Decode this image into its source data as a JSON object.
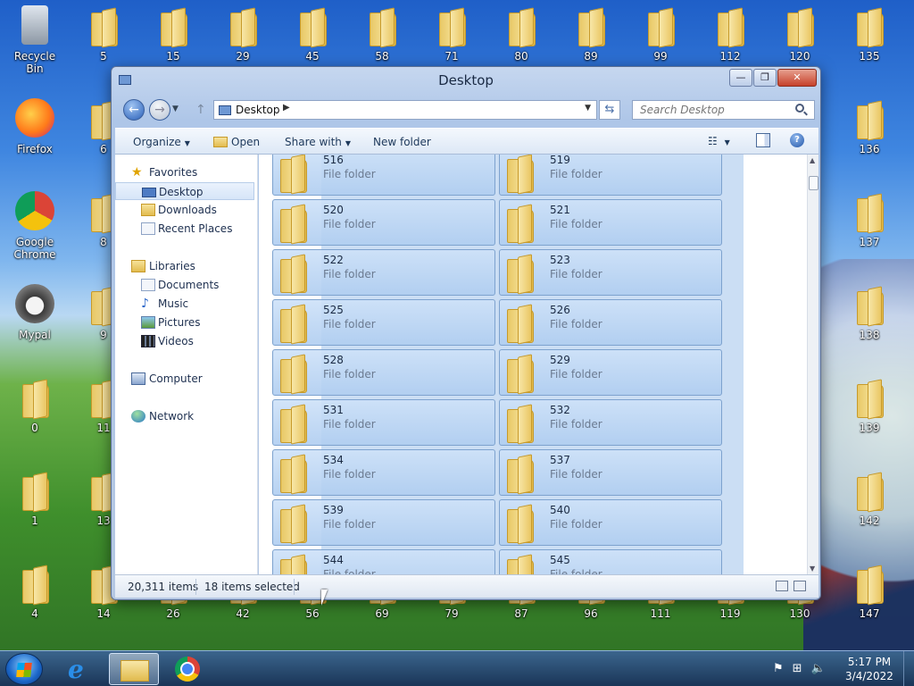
{
  "desktop": {
    "top_row": [
      "Recycle Bin",
      "5",
      "15",
      "29",
      "45",
      "58",
      "71",
      "80",
      "89",
      "99",
      "112",
      "120",
      "135"
    ],
    "left_col": [
      "Firefox",
      "Google Chrome",
      "Mypal"
    ],
    "left_folders": [
      "6",
      "8",
      "9",
      "11",
      "13"
    ],
    "bottom_left": [
      "0",
      "1"
    ],
    "bottom_row": [
      "4",
      "14",
      "26",
      "42",
      "56",
      "69",
      "79",
      "87",
      "96",
      "111",
      "119",
      "130"
    ],
    "right_col": [
      "136",
      "137",
      "138",
      "139",
      "142",
      "147"
    ]
  },
  "window": {
    "title": "Desktop",
    "address": "Desktop",
    "search_placeholder": "Search Desktop"
  },
  "toolbar": {
    "organize": "Organize",
    "open": "Open",
    "share_with": "Share with",
    "new_folder": "New folder"
  },
  "navpane": {
    "favorites": "Favorites",
    "desktop": "Desktop",
    "downloads": "Downloads",
    "recent_places": "Recent Places",
    "libraries": "Libraries",
    "documents": "Documents",
    "music": "Music",
    "pictures": "Pictures",
    "videos": "Videos",
    "computer": "Computer",
    "network": "Network"
  },
  "files": {
    "type_label": "File folder",
    "rows": [
      [
        "516",
        "519"
      ],
      [
        "520",
        "521"
      ],
      [
        "522",
        "523"
      ],
      [
        "525",
        "526"
      ],
      [
        "528",
        "529"
      ],
      [
        "531",
        "532"
      ],
      [
        "534",
        "537"
      ],
      [
        "539",
        "540"
      ],
      [
        "544",
        "545"
      ]
    ]
  },
  "status": {
    "item_count": "20,311 items",
    "selected": "18 items selected"
  },
  "taskbar": {
    "time": "5:17 PM",
    "date": "3/4/2022"
  }
}
